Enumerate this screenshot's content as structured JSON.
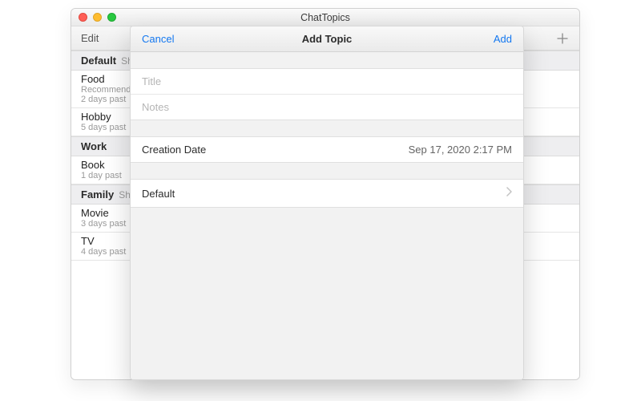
{
  "window": {
    "title": "ChatTopics"
  },
  "toolbar": {
    "edit_label": "Edit"
  },
  "sections": {
    "default": {
      "title": "Default",
      "suffix": "Sho",
      "topics": [
        {
          "title": "Food",
          "sub": "Recommendatio",
          "meta": "2 days past"
        },
        {
          "title": "Hobby",
          "meta": "5 days past"
        }
      ]
    },
    "work": {
      "title": "Work",
      "topics": [
        {
          "title": "Book",
          "meta": "1 day past"
        }
      ]
    },
    "family": {
      "title": "Family",
      "suffix": "Shov",
      "topics": [
        {
          "title": "Movie",
          "meta": "3 days past"
        },
        {
          "title": "TV",
          "meta": "4 days past"
        }
      ]
    }
  },
  "sheet": {
    "cancel_label": "Cancel",
    "title": "Add Topic",
    "add_label": "Add",
    "title_placeholder": "Title",
    "notes_placeholder": "Notes",
    "creation_date_label": "Creation Date",
    "creation_date_value": "Sep 17, 2020 2:17 PM",
    "category_value": "Default"
  }
}
